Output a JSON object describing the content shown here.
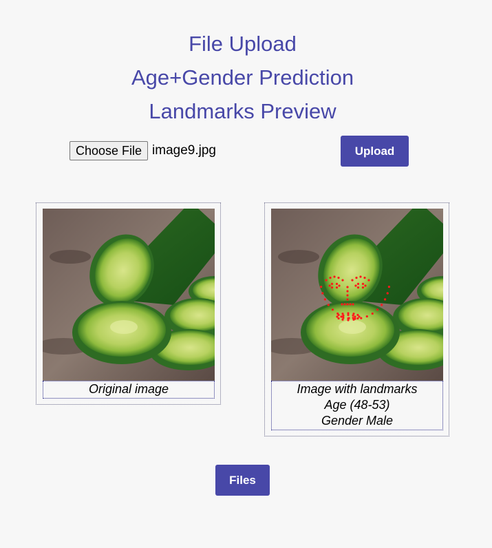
{
  "headings": {
    "file_upload": "File Upload",
    "prediction": "Age+Gender Prediction",
    "landmarks": "Landmarks Preview"
  },
  "file_input": {
    "button_label": "Choose File",
    "file_name": "image9.jpg"
  },
  "buttons": {
    "upload": "Upload",
    "files": "Files"
  },
  "original": {
    "caption": "Original image"
  },
  "landmarks": {
    "caption_line1": "Image with landmarks",
    "age": "Age (48-53)",
    "gender": "Gender Male"
  },
  "colors": {
    "accent": "#4848a8",
    "background": "#f7f7f7",
    "landmark_dots": "#ff0000"
  }
}
